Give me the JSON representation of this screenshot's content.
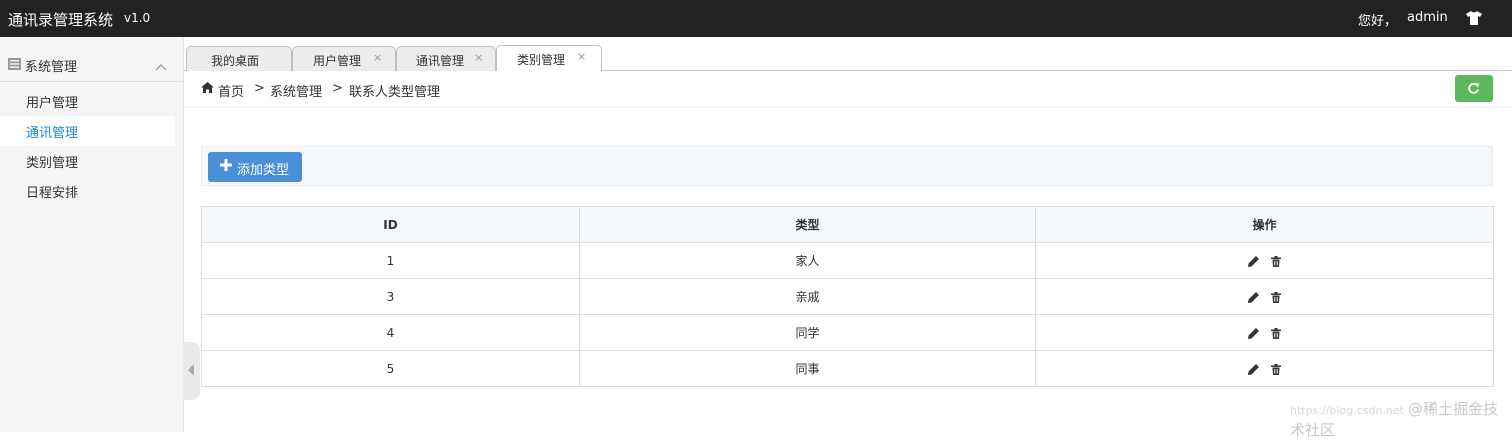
{
  "header": {
    "app_title": "通讯录管理系统",
    "version": "v1.0",
    "greeting": "您好，",
    "username": "admin",
    "icon": "shirt-icon"
  },
  "sidebar": {
    "section_label": "系统管理",
    "items": [
      {
        "label": "用户管理",
        "active": false
      },
      {
        "label": "通讯管理",
        "active": true
      },
      {
        "label": "类别管理",
        "active": false
      },
      {
        "label": "日程安排",
        "active": false
      }
    ]
  },
  "tabs": [
    {
      "label": "我的桌面",
      "closable": false,
      "active": false
    },
    {
      "label": "用户管理",
      "closable": true,
      "active": false
    },
    {
      "label": "通讯管理",
      "closable": true,
      "active": false
    },
    {
      "label": "类别管理",
      "closable": true,
      "active": true
    }
  ],
  "tab_close_glyph": "×",
  "breadcrumb": {
    "home": "首页",
    "separator": ">",
    "level1": "系统管理",
    "level2": "联系人类型管理"
  },
  "toolbar": {
    "add_label": "添加类型"
  },
  "table": {
    "columns": [
      "ID",
      "类型",
      "操作"
    ],
    "rows": [
      {
        "id": "1",
        "type": "家人"
      },
      {
        "id": "3",
        "type": "亲戚"
      },
      {
        "id": "4",
        "type": "同学"
      },
      {
        "id": "5",
        "type": "同事"
      }
    ]
  },
  "watermark": {
    "url": "https://blog.csdn.net",
    "text": "@稀土掘金技术社区"
  },
  "colors": {
    "topbar": "#222222",
    "accent": "#1e88d0",
    "add_button": "#4a90d9",
    "refresh_button": "#5cb85c"
  }
}
